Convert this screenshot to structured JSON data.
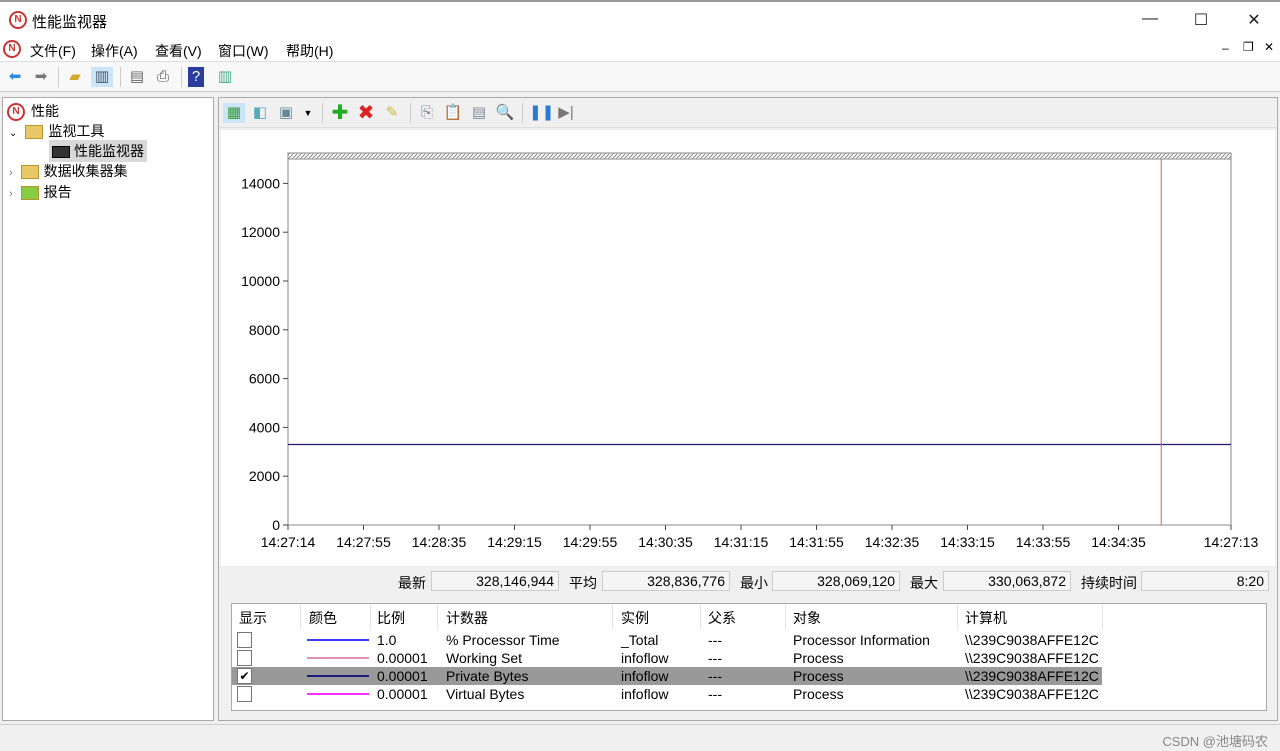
{
  "window": {
    "title": "性能监视器",
    "min": "—",
    "max": "☐",
    "close": "✕"
  },
  "menu": [
    "文件(F)",
    "操作(A)",
    "查看(V)",
    "窗口(W)",
    "帮助(H)"
  ],
  "tree": {
    "root": "性能",
    "tools": "监视工具",
    "perfmon": "性能监视器",
    "dcs": "数据收集器集",
    "reports": "报告"
  },
  "stats": {
    "last_label": "最新",
    "last": "328,146,944",
    "avg_label": "平均",
    "avg": "328,836,776",
    "min_label": "最小",
    "min": "328,069,120",
    "max_label": "最大",
    "max": "330,063,872",
    "dur_label": "持续时间",
    "dur": "8:20"
  },
  "legend": {
    "headers": [
      "显示",
      "颜色",
      "比例",
      "计数器",
      "实例",
      "父系",
      "对象",
      "计算机"
    ],
    "rows": [
      {
        "show": false,
        "color": "#3a3aff",
        "scale": "1.0",
        "counter": "% Processor Time",
        "instance": "_Total",
        "parent": "---",
        "object": "Processor Information",
        "computer": "\\\\239C9038AFFE12C"
      },
      {
        "show": false,
        "color": "#e090b0",
        "scale": "0.00001",
        "counter": "Working Set",
        "instance": "infoflow",
        "parent": "---",
        "object": "Process",
        "computer": "\\\\239C9038AFFE12C"
      },
      {
        "show": true,
        "color": "#1a1a80",
        "scale": "0.00001",
        "counter": "Private Bytes",
        "instance": "infoflow",
        "parent": "---",
        "object": "Process",
        "computer": "\\\\239C9038AFFE12C"
      },
      {
        "show": false,
        "color": "#ff30ff",
        "scale": "0.00001",
        "counter": "Virtual Bytes",
        "instance": "infoflow",
        "parent": "---",
        "object": "Process",
        "computer": "\\\\239C9038AFFE12C"
      }
    ]
  },
  "chart_data": {
    "type": "line",
    "ylim": [
      0,
      15000
    ],
    "yticks": [
      "0",
      "2000",
      "4000",
      "6000",
      "8000",
      "10000",
      "12000",
      "14000"
    ],
    "xticks": [
      "14:27:14",
      "14:27:55",
      "14:28:35",
      "14:29:15",
      "14:29:55",
      "14:30:35",
      "14:31:15",
      "14:31:55",
      "14:32:35",
      "14:33:15",
      "14:33:55",
      "14:34:35",
      "14:27:13"
    ],
    "series": [
      {
        "name": "Private Bytes",
        "color": "#1a1a80",
        "value": 3300
      }
    ],
    "current_time_fraction": 0.926
  },
  "watermark": "CSDN @池塘码农"
}
